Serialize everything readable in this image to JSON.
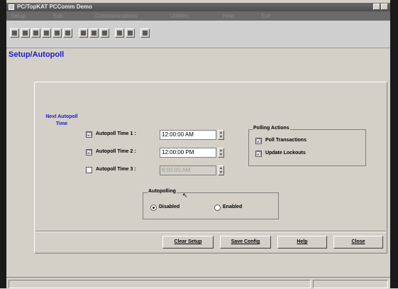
{
  "window": {
    "title": "PC/TopKAT PCComm Demo"
  },
  "menu": [
    "Setup",
    "Edit",
    "Communications",
    "Utilities",
    "Help",
    "Exit"
  ],
  "toolbar": {
    "icons": [
      "grid-icon",
      "list-icon",
      "chart-icon",
      "flag-icon",
      "graph-icon",
      "circle-icon",
      "house-icon",
      "building-icon",
      "magnify-icon",
      "table-icon",
      "book-icon",
      "page-icon"
    ]
  },
  "page": {
    "title": "Setup/Autopoll"
  },
  "next_autopoll_label": "Next Autopoll Time",
  "autopoll_times": [
    {
      "label": "Autopoll Time 1 :",
      "checked": true,
      "mark": "☑",
      "value": "12:00:00 AM",
      "enabled": true
    },
    {
      "label": "Autopoll Time 2 :",
      "checked": true,
      "mark": "☑",
      "value": "12:00:00 PM",
      "enabled": true
    },
    {
      "label": "Autopoll Time 3 :",
      "checked": false,
      "mark": "",
      "value": "6:00:00 AM",
      "enabled": false
    }
  ],
  "polling_actions": {
    "title": "Polling Actions",
    "items": [
      {
        "label": "Poll Transactions",
        "checked": true,
        "mark": "☑"
      },
      {
        "label": "Update Lockouts",
        "checked": true,
        "mark": "☑"
      }
    ]
  },
  "autopolling": {
    "title": "Autopolling",
    "options": [
      {
        "label": "Disabled",
        "selected": true
      },
      {
        "label": "Enabled",
        "selected": false
      }
    ]
  },
  "buttons": {
    "clear": "Clear Setup",
    "save": "Save Config",
    "help": "Help",
    "close": "Close"
  }
}
